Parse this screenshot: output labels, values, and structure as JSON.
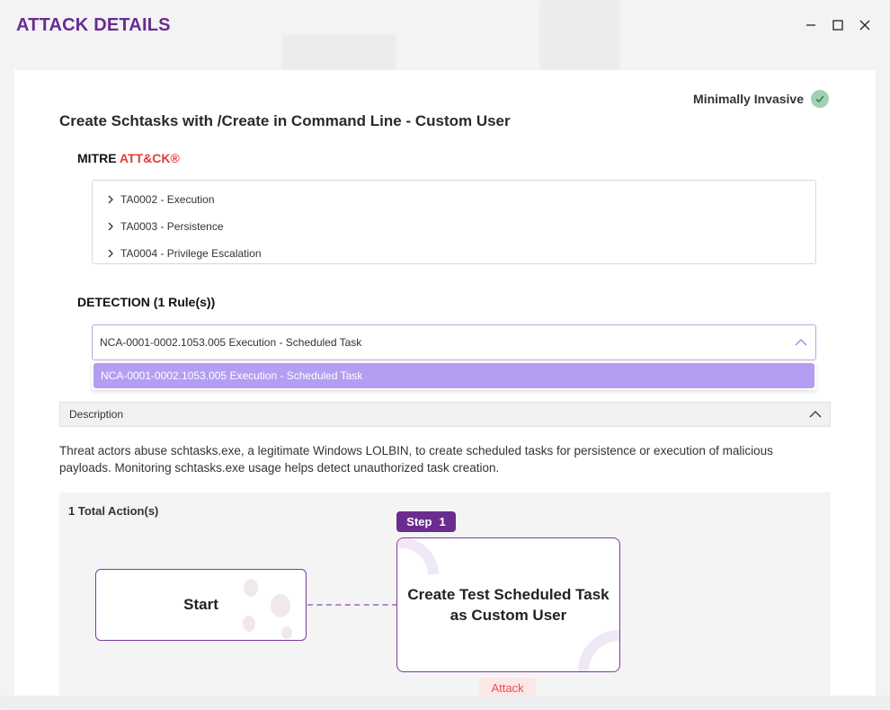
{
  "window": {
    "title": "ATTACK DETAILS"
  },
  "attack": {
    "invasiveness_label": "Minimally Invasive",
    "title": "Create Schtasks with /Create in Command Line - Custom User"
  },
  "mitre": {
    "label_prefix": "MITRE",
    "label_brand": "ATT&CK®",
    "brand_color": "#e23b3b",
    "tactics": [
      {
        "label": "TA0002 - Execution"
      },
      {
        "label": "TA0003 - Persistence"
      },
      {
        "label": "TA0004 - Privilege Escalation"
      }
    ]
  },
  "detection": {
    "label": "DETECTION (1 Rule(s))",
    "selected_rule": "NCA-0001-0002.1053.005 Execution - Scheduled Task",
    "options": [
      "NCA-0001-0002.1053.005 Execution - Scheduled Task"
    ]
  },
  "description": {
    "header": "Description",
    "text": "Threat actors abuse schtasks.exe, a legitimate Windows LOLBIN, to create scheduled tasks for persistence or execution of malicious payloads. Monitoring schtasks.exe usage helps detect unauthorized task creation."
  },
  "flow": {
    "total_actions": "1 Total Action(s)",
    "start_label": "Start",
    "step": {
      "badge_word": "Step",
      "badge_number": "1",
      "title": "Create Test Scheduled Task as Custom User",
      "tag": "Attack"
    }
  },
  "colors": {
    "brand_purple": "#6a2c8e",
    "selection_lavender": "#b39ef3",
    "success_green": "#9fd1b4",
    "attack_red": "#e15252"
  }
}
